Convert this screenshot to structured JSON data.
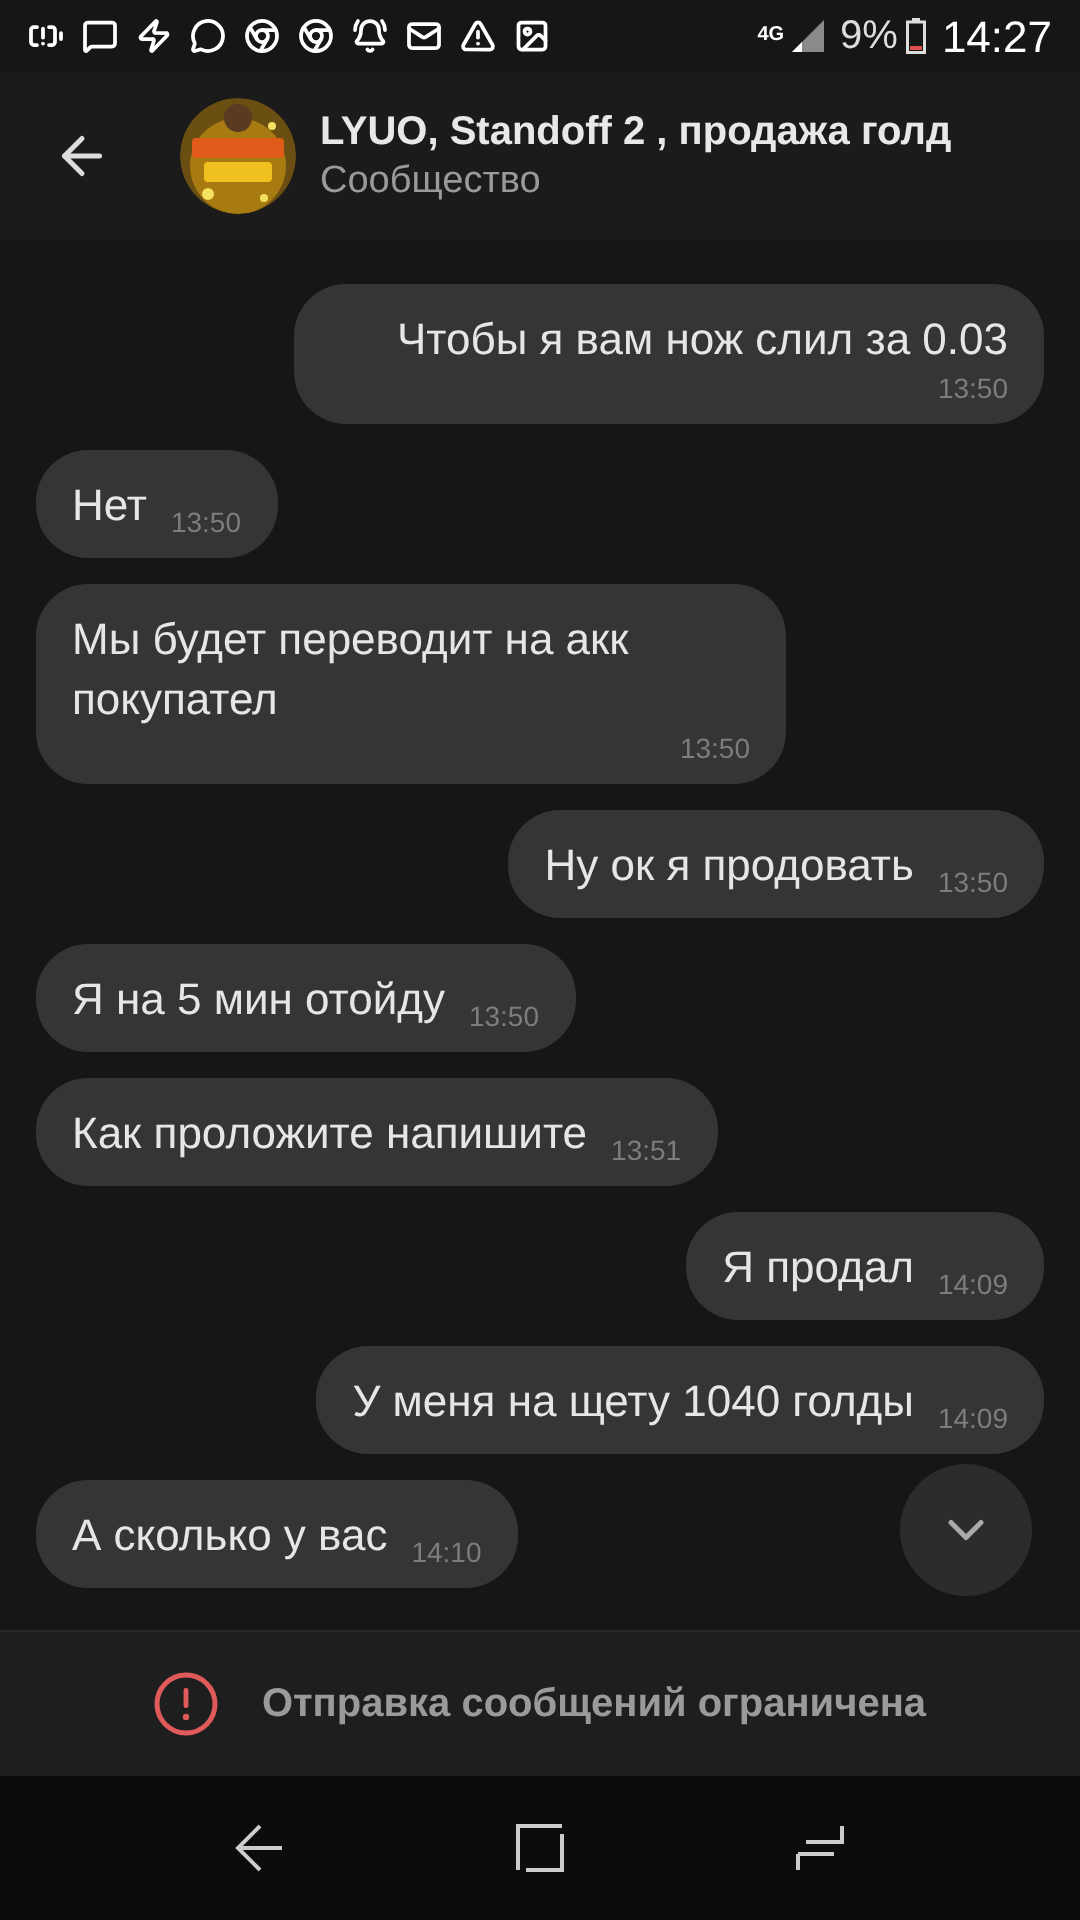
{
  "status_bar": {
    "network": "4G",
    "battery": "9%",
    "time": "14:27"
  },
  "header": {
    "title": "LYUO, Standoff 2 , продажа голд",
    "subtitle": "Сообщество"
  },
  "messages": [
    {
      "kind": "outgoing",
      "text": "Чтобы я вам нож слил за 0.03",
      "time": "13:50"
    },
    {
      "kind": "incoming",
      "text": "Нет",
      "time": "13:50"
    },
    {
      "kind": "incoming",
      "text": "Мы будет переводит на акк покупател",
      "time": "13:50"
    },
    {
      "kind": "outgoing",
      "text": "Ну ок я продовать",
      "time": "13:50"
    },
    {
      "kind": "incoming",
      "text": "Я на 5 мин отойду",
      "time": "13:50"
    },
    {
      "kind": "incoming",
      "text": "Как проложите напишите",
      "time": "13:51"
    },
    {
      "kind": "outgoing",
      "text": "Я продал",
      "time": "14:09"
    },
    {
      "kind": "outgoing",
      "text": "У меня на щету 1040 голды",
      "time": "14:09"
    },
    {
      "kind": "incoming",
      "text": "А сколько у вас",
      "time": "14:10"
    }
  ],
  "notice": "Отправка сообщений ограничена"
}
